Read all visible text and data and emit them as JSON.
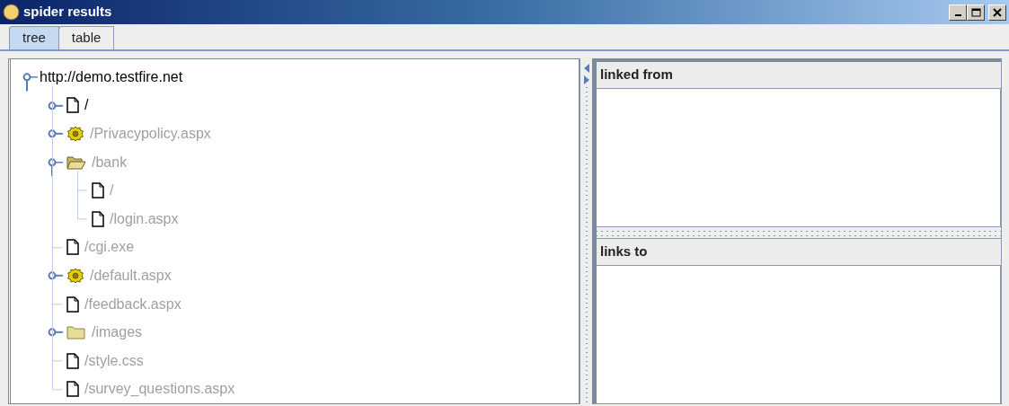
{
  "window": {
    "title": "spider results"
  },
  "tabs": [
    {
      "label": "tree",
      "selected": true
    },
    {
      "label": "table",
      "selected": false
    }
  ],
  "tree": [
    {
      "label": "http://demo.testfire.net",
      "expanded": true,
      "dimmed": false,
      "children": [
        {
          "label": "/",
          "kind": "page",
          "expanded": false,
          "dimmed": false
        },
        {
          "label": "/Privacypolicy.aspx",
          "kind": "script",
          "expanded": false,
          "dimmed": true
        },
        {
          "label": "/bank",
          "kind": "folder",
          "expanded": true,
          "dimmed": true,
          "children": [
            {
              "label": "/",
              "kind": "page",
              "dimmed": true
            },
            {
              "label": "/login.aspx",
              "kind": "page",
              "dimmed": true
            }
          ]
        },
        {
          "label": "/cgi.exe",
          "kind": "page",
          "dimmed": true
        },
        {
          "label": "/default.aspx",
          "kind": "script",
          "expanded": false,
          "dimmed": true
        },
        {
          "label": "/feedback.aspx",
          "kind": "page",
          "dimmed": true
        },
        {
          "label": "/images",
          "kind": "folder",
          "expanded": false,
          "dimmed": true
        },
        {
          "label": "/style.css",
          "kind": "page",
          "dimmed": true
        },
        {
          "label": "/survey_questions.aspx",
          "kind": "page",
          "dimmed": true
        }
      ]
    }
  ],
  "panels": [
    {
      "title": "linked from"
    },
    {
      "title": "links to"
    }
  ]
}
